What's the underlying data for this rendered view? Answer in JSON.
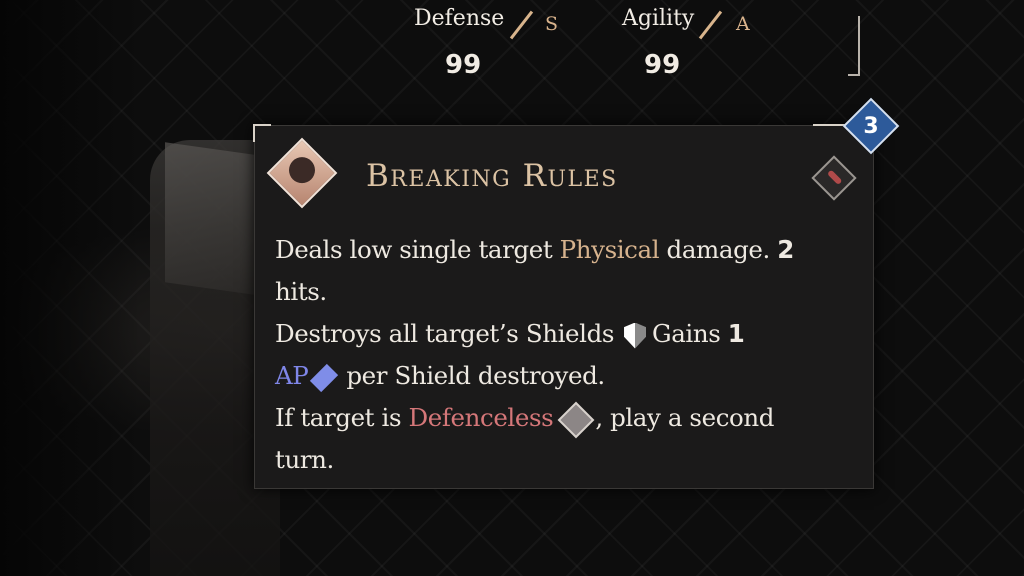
{
  "stats": {
    "defense": {
      "label": "Defense",
      "rank": "S",
      "value": "99"
    },
    "agility": {
      "label": "Agility",
      "rank": "A",
      "value": "99"
    }
  },
  "skill": {
    "title": "Breaking Rules",
    "ap_cost": "3",
    "description": {
      "line1_a": "Deals low single target ",
      "line1_physical": "Physical",
      "line1_b": " damage. ",
      "line1_num": "2",
      "line2": "hits.",
      "line3_a": "Destroys all target’s Shields",
      "line3_b": "Gains ",
      "line3_num": "1",
      "line4_ap": "AP",
      "line4_b": "per Shield destroyed.",
      "line5_a": "If target is ",
      "line5_defenceless": "Defenceless",
      "line5_b": ", play a second",
      "line6": "turn."
    }
  },
  "colors": {
    "title": "#dcc3a4",
    "physical": "#d6b28d",
    "ap": "#7f86e8",
    "defenceless": "#d57779",
    "cost_badge": "#2d5a9a"
  },
  "icons": {
    "skill": "breaking-rules-skill-icon",
    "type": "physical-type-icon",
    "shield": "shield-icon",
    "ap": "ap-diamond-icon",
    "defenceless": "defenceless-icon"
  }
}
